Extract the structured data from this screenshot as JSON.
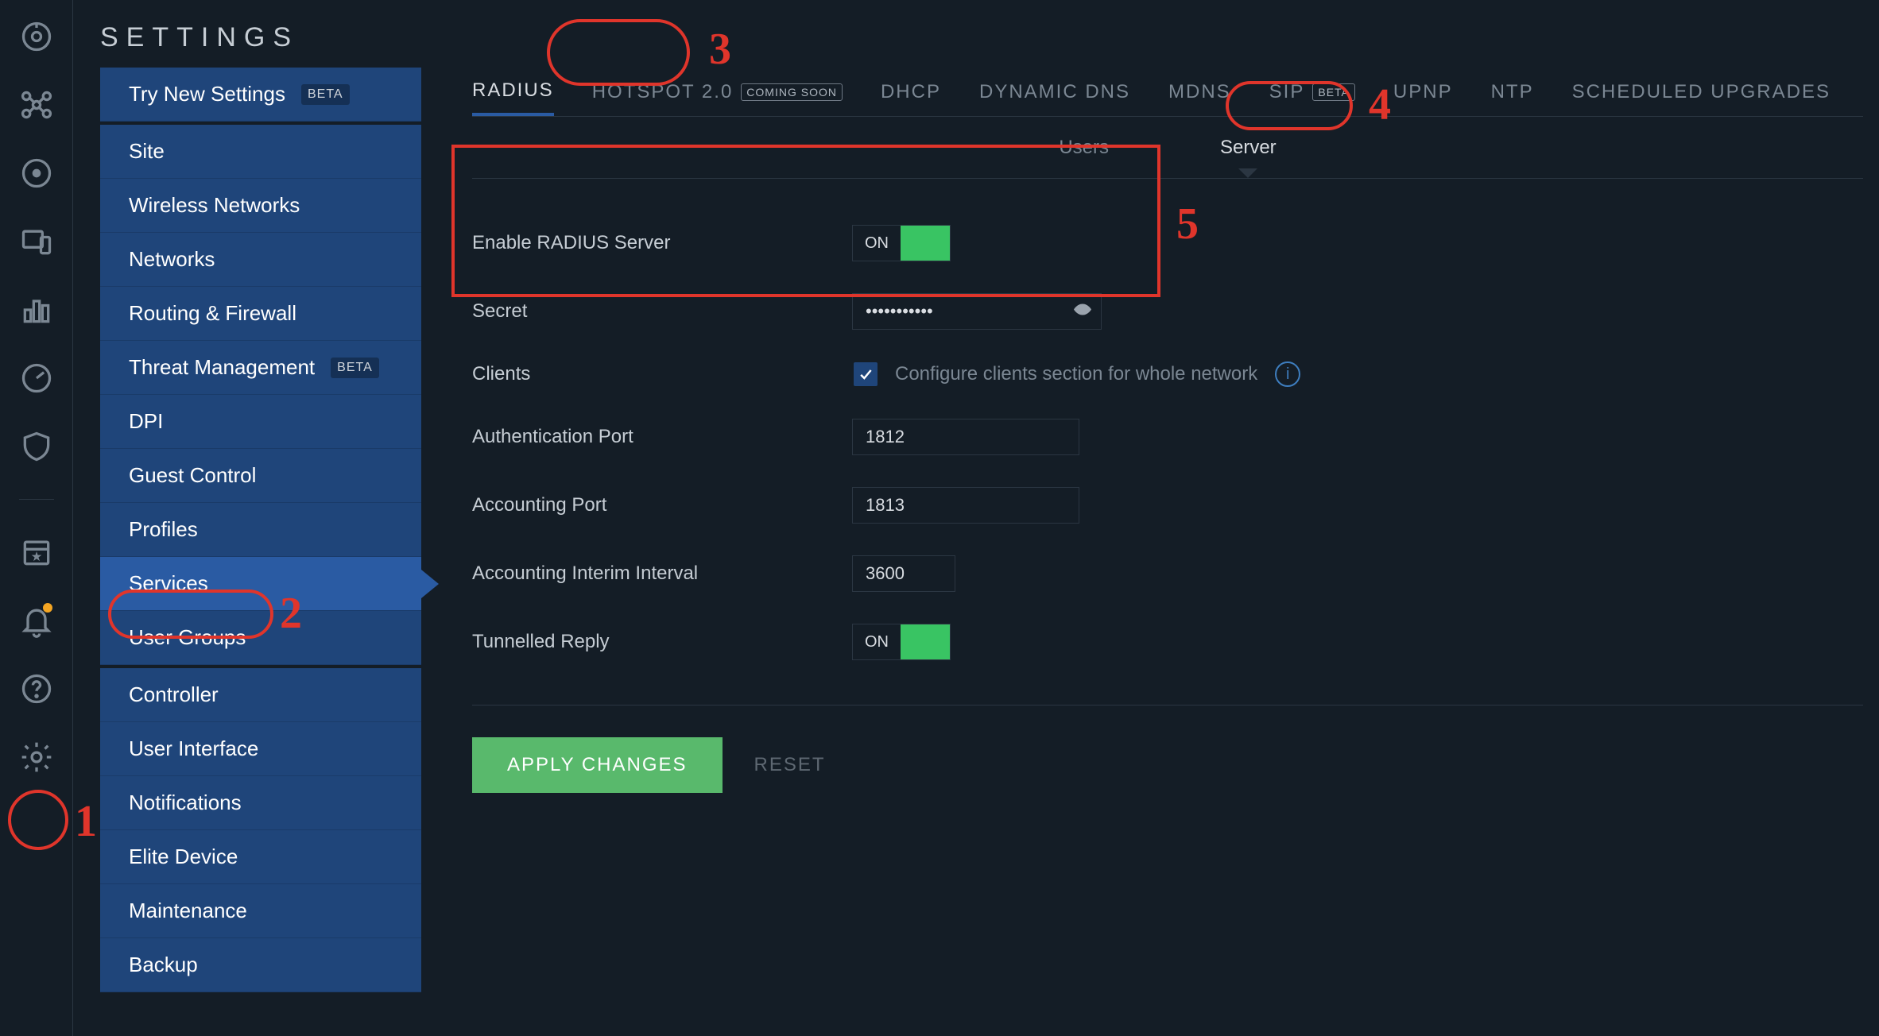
{
  "app": {
    "title": "SETTINGS"
  },
  "rail": {
    "icons": [
      {
        "name": "dashboard-icon"
      },
      {
        "name": "topology-icon"
      },
      {
        "name": "circle-icon"
      },
      {
        "name": "devices-icon"
      },
      {
        "name": "insights-icon"
      },
      {
        "name": "gauge-icon"
      },
      {
        "name": "shield-icon"
      }
    ],
    "lower_icons": [
      {
        "name": "calendar-icon",
        "badged": false
      },
      {
        "name": "bell-icon",
        "badged": true
      },
      {
        "name": "help-icon",
        "badged": false
      },
      {
        "name": "gear-icon",
        "badged": false
      }
    ]
  },
  "sidebar": {
    "groups": [
      {
        "items": [
          {
            "label": "Try New Settings",
            "badge": "BETA"
          }
        ]
      },
      {
        "items": [
          {
            "label": "Site"
          },
          {
            "label": "Wireless Networks"
          },
          {
            "label": "Networks"
          },
          {
            "label": "Routing & Firewall"
          },
          {
            "label": "Threat Management",
            "badge": "BETA"
          },
          {
            "label": "DPI"
          },
          {
            "label": "Guest Control"
          },
          {
            "label": "Profiles"
          },
          {
            "label": "Services",
            "active": true
          },
          {
            "label": "User Groups"
          }
        ]
      },
      {
        "items": [
          {
            "label": "Controller"
          },
          {
            "label": "User Interface"
          },
          {
            "label": "Notifications"
          },
          {
            "label": "Elite Device"
          },
          {
            "label": "Maintenance"
          },
          {
            "label": "Backup"
          }
        ]
      }
    ]
  },
  "tabs": [
    {
      "label": "RADIUS",
      "active": true
    },
    {
      "label": "HOTSPOT 2.0",
      "badge": "COMING SOON"
    },
    {
      "label": "DHCP"
    },
    {
      "label": "DYNAMIC DNS"
    },
    {
      "label": "MDNS"
    },
    {
      "label": "SIP",
      "badge": "BETA"
    },
    {
      "label": "UPNP"
    },
    {
      "label": "NTP"
    },
    {
      "label": "SCHEDULED UPGRADES"
    }
  ],
  "subtabs": [
    {
      "label": "Users"
    },
    {
      "label": "Server",
      "active": true
    }
  ],
  "form": {
    "enable_label": "Enable RADIUS Server",
    "enable_state": "ON",
    "secret_label": "Secret",
    "secret_value": "•••••••••••",
    "clients_label": "Clients",
    "clients_cfg": "Configure clients section for whole network",
    "auth_port_label": "Authentication Port",
    "auth_port_value": "1812",
    "acct_port_label": "Accounting Port",
    "acct_port_value": "1813",
    "interim_label": "Accounting Interim Interval",
    "interim_value": "3600",
    "tunnel_label": "Tunnelled Reply",
    "tunnel_state": "ON"
  },
  "actions": {
    "apply": "APPLY CHANGES",
    "reset": "RESET"
  },
  "annotations": {
    "n1": "1",
    "n2": "2",
    "n3": "3",
    "n4": "4",
    "n5": "5"
  }
}
